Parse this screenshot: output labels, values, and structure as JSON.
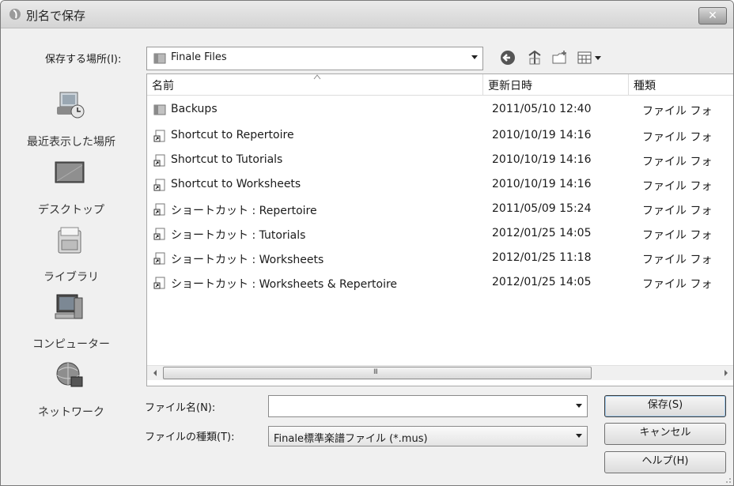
{
  "window": {
    "title": "別名で保存",
    "close_label": "✕"
  },
  "lookin": {
    "label": "保存する場所(I):",
    "value": "Finale Files"
  },
  "places": [
    {
      "label": "最近表示した場所",
      "icon": "recent-places-icon"
    },
    {
      "label": "デスクトップ",
      "icon": "desktop-icon"
    },
    {
      "label": "ライブラリ",
      "icon": "libraries-icon"
    },
    {
      "label": "コンピューター",
      "icon": "computer-icon"
    },
    {
      "label": "ネットワーク",
      "icon": "network-icon"
    }
  ],
  "columns": {
    "name": "名前",
    "date": "更新日時",
    "type": "種類"
  },
  "files": [
    {
      "name": "Backups",
      "date": "2011/05/10 12:40",
      "type": "ファイル フォ",
      "icon": "folder-icon"
    },
    {
      "name": "Shortcut to Repertoire",
      "date": "2010/10/19 14:16",
      "type": "ファイル フォ",
      "icon": "shortcut-icon"
    },
    {
      "name": "Shortcut to Tutorials",
      "date": "2010/10/19 14:16",
      "type": "ファイル フォ",
      "icon": "shortcut-icon"
    },
    {
      "name": "Shortcut to Worksheets",
      "date": "2010/10/19 14:16",
      "type": "ファイル フォ",
      "icon": "shortcut-icon"
    },
    {
      "name": "ショートカット : Repertoire",
      "date": "2011/05/09 15:24",
      "type": "ファイル フォ",
      "icon": "shortcut-icon"
    },
    {
      "name": "ショートカット : Tutorials",
      "date": "2012/01/25 14:05",
      "type": "ファイル フォ",
      "icon": "shortcut-icon"
    },
    {
      "name": "ショートカット : Worksheets",
      "date": "2012/01/25 11:18",
      "type": "ファイル フォ",
      "icon": "shortcut-icon"
    },
    {
      "name": "ショートカット : Worksheets & Repertoire",
      "date": "2012/01/25 14:05",
      "type": "ファイル フォ",
      "icon": "shortcut-icon"
    }
  ],
  "scrollbar": {
    "grip": "III"
  },
  "filename": {
    "label": "ファイル名(N):",
    "value": ""
  },
  "filetype": {
    "label": "ファイルの種類(T):",
    "value": "Finale標準楽譜ファイル (*.mus)"
  },
  "buttons": {
    "save": "保存(S)",
    "cancel": "キャンセル",
    "help": "ヘルプ(H)"
  }
}
